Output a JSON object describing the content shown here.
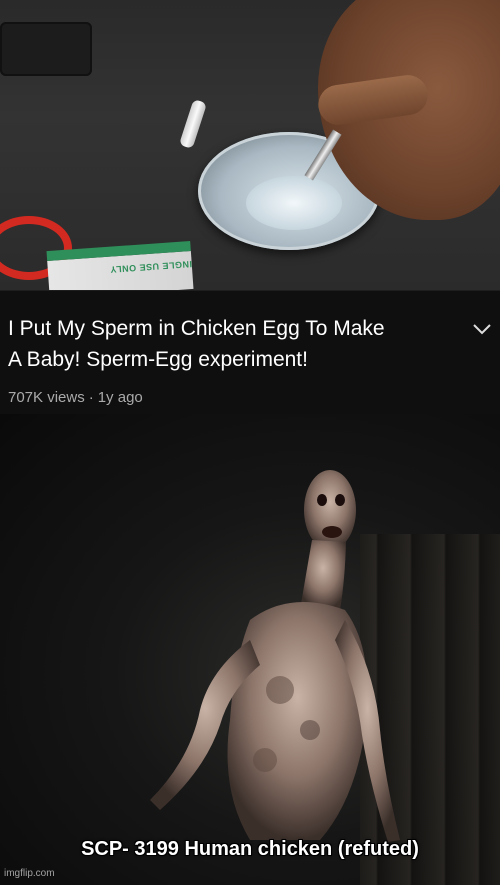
{
  "video": {
    "title_line1": "I Put My Sperm in Chicken Egg To Make",
    "title_line2": "A Baby! Sperm-Egg experiment!",
    "views": "707K views",
    "separator": "·",
    "age": "1y ago"
  },
  "packet_text": "SINGLE USE ONLY",
  "caption": "SCP- 3199 Human chicken (refuted)",
  "watermark": "imgflip.com",
  "colors": {
    "info_bar_bg": "#0f0f0f",
    "title_text": "#ffffff",
    "meta_text": "#aaaaaa"
  }
}
